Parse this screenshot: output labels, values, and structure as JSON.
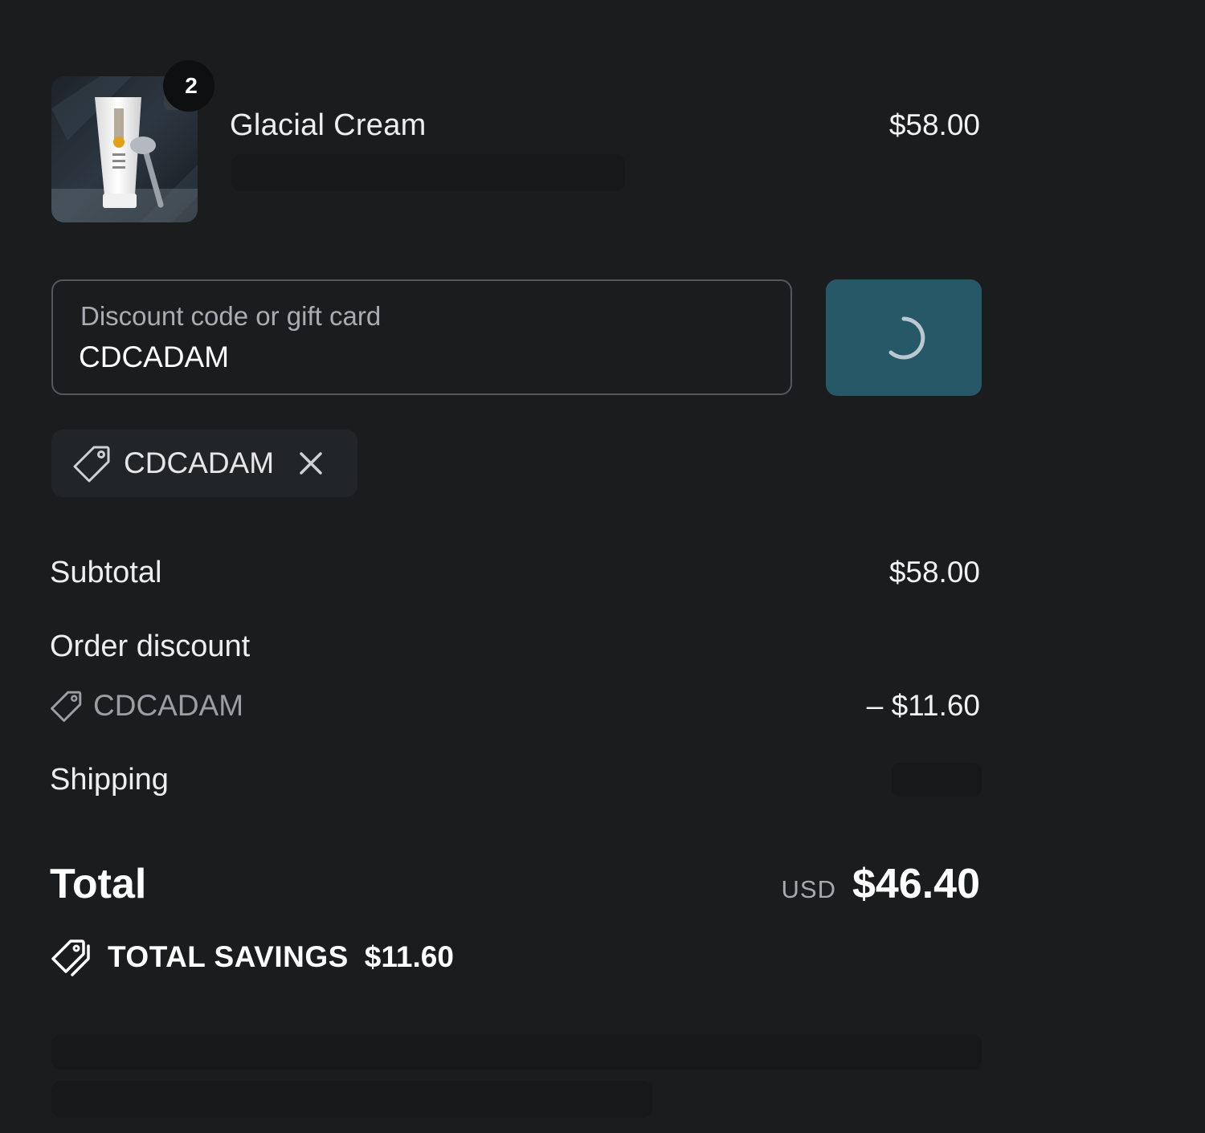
{
  "line_item": {
    "title": "Glacial Cream",
    "price": "$58.00",
    "quantity": "2",
    "image_icon": "product-image"
  },
  "discount_form": {
    "label": "Discount code or gift card",
    "value": "CDCADAM",
    "apply_button_state": "loading",
    "apply_button_color": "#265868"
  },
  "applied_discount": {
    "code": "CDCADAM",
    "tag_icon": "tag-icon",
    "remove_icon": "close-icon"
  },
  "summary": {
    "subtotal_label": "Subtotal",
    "subtotal_value": "$58.00",
    "order_discount_label": "Order discount",
    "order_discount_code": "CDCADAM",
    "order_discount_value": "– $11.60",
    "shipping_label": "Shipping",
    "total_label": "Total",
    "currency": "USD",
    "total_value": "$46.40",
    "savings_label": "TOTAL SAVINGS",
    "savings_value": "$11.60"
  }
}
